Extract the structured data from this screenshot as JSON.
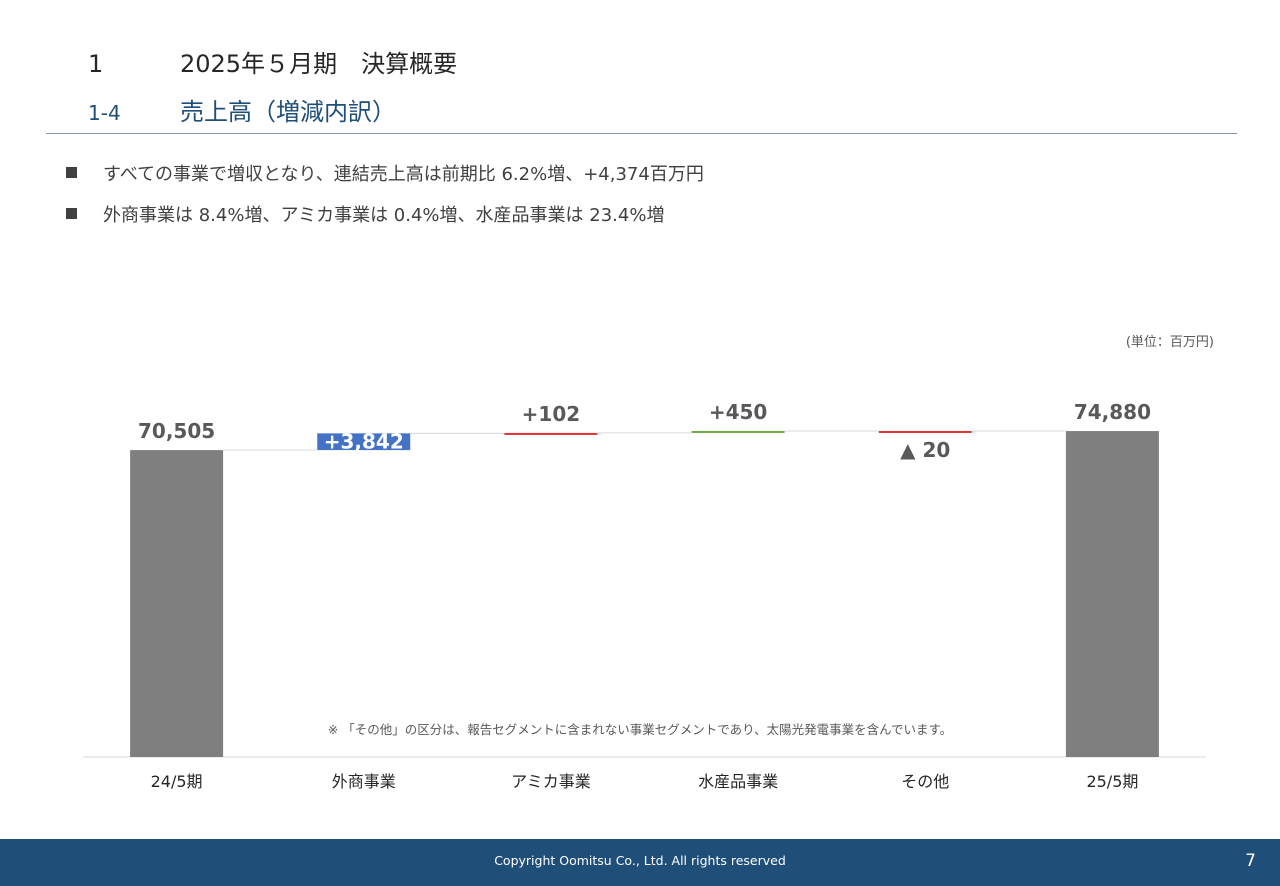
{
  "header": {
    "section_number": "1",
    "section_title": "2025年５月期　決算概要",
    "subsection_number": "1-4",
    "subsection_title": "売上高（増減内訳）"
  },
  "bullets": [
    "すべての事業で増収となり、連結売上高は前期比 6.2%増、+4,374百万円",
    "外商事業は 8.4%増、アミカ事業は 0.4%増、水産品事業は 23.4%増"
  ],
  "unit_note": "(単位：百万円)",
  "footnote": "※ 「その他」の区分は、報告セグメントに含まれない事業セグメントであり、太陽光発電事業を含んでいます。",
  "footer": {
    "copyright": "Copyright Oomitsu Co., Ltd. All rights reserved",
    "page_number": "7"
  },
  "colors": {
    "total": "#7f7f7f",
    "gaishou": "#4472c4",
    "amica": "#e03030",
    "suisan": "#70ad47",
    "other": "#e03030",
    "title_blue": "#1f4e79"
  },
  "chart_data": {
    "type": "bar",
    "subtype": "waterfall",
    "categories": [
      "24/5期",
      "外商事業",
      "アミカ事業",
      "水産品事業",
      "その他",
      "25/5期"
    ],
    "values": [
      70505,
      3842,
      102,
      450,
      -20,
      74880
    ],
    "kinds": [
      "total",
      "delta",
      "delta",
      "delta",
      "delta",
      "total"
    ],
    "labels": [
      "70,505",
      "+3,842",
      "+102",
      "+450",
      "▲ 20",
      "74,880"
    ],
    "ylim": [
      0,
      76500
    ],
    "grid": false,
    "legend": "none"
  }
}
